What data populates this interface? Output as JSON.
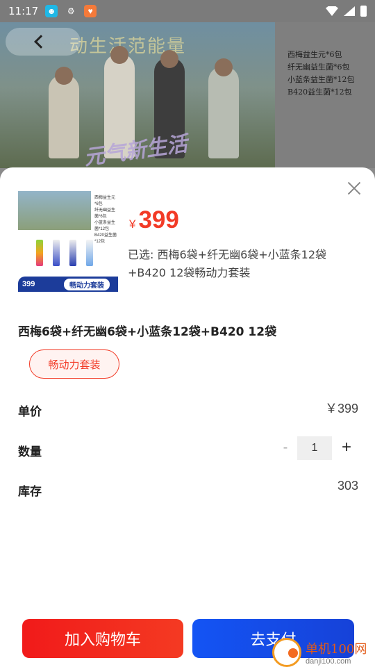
{
  "status_bar": {
    "time": "11:17"
  },
  "hero": {
    "banner_text": "动生活范能量",
    "logo_text": "元气新生活",
    "side_list": [
      "西梅益生元*6包",
      "纤无幽益生菌*6包",
      "小蓝条益生菌*12包",
      "B420益生菌*12包"
    ]
  },
  "sheet": {
    "thumbnail": {
      "list": [
        "西梅益生元*6包",
        "纤无幽益生菌*6包",
        "小蓝条益生菌*12包",
        "B420益生菌*12包"
      ],
      "price": "399",
      "label": "畅动力套装"
    },
    "price_currency": "¥",
    "price": "399",
    "selected": "已选: 西梅6袋+纤无幽6袋+小蓝条12袋+B420 12袋畅动力套装",
    "product_title": "西梅6袋+纤无幽6袋+小蓝条12袋+B420 12袋",
    "spec_option": "畅动力套装",
    "unit_price_label": "单价",
    "unit_price_value": "￥399",
    "quantity_label": "数量",
    "quantity_minus": "-",
    "quantity_value": "1",
    "quantity_plus": "+",
    "stock_label": "库存",
    "stock_value": "303",
    "add_to_cart": "加入购物车",
    "checkout": "去支付"
  },
  "watermark": {
    "name": "单机100网",
    "url": "danji100.com"
  },
  "colors": {
    "accent_red": "#f23b27",
    "cart_red": "#f11a1a",
    "pay_blue": "#1454f4"
  }
}
